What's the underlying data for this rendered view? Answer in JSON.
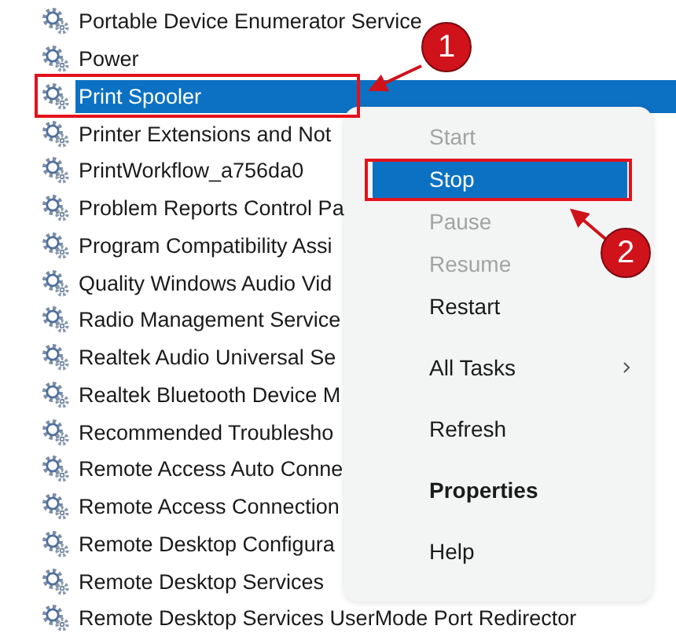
{
  "services": [
    {
      "name": "Portable Device Enumerator Service",
      "selected": false
    },
    {
      "name": "Power",
      "selected": false
    },
    {
      "name": "Print Spooler",
      "selected": true
    },
    {
      "name": "Printer Extensions and Not",
      "selected": false
    },
    {
      "name": "PrintWorkflow_a756da0",
      "selected": false
    },
    {
      "name": "Problem Reports Control Pa",
      "selected": false
    },
    {
      "name": "Program Compatibility Assi",
      "selected": false
    },
    {
      "name": "Quality Windows Audio Vid",
      "selected": false
    },
    {
      "name": "Radio Management Service",
      "selected": false
    },
    {
      "name": "Realtek Audio Universal Se",
      "selected": false
    },
    {
      "name": "Realtek Bluetooth Device M",
      "selected": false
    },
    {
      "name": "Recommended Troublesho",
      "selected": false
    },
    {
      "name": "Remote Access Auto Conne",
      "selected": false
    },
    {
      "name": "Remote Access Connection",
      "selected": false
    },
    {
      "name": "Remote Desktop Configura",
      "selected": false
    },
    {
      "name": "Remote Desktop Services",
      "selected": false
    },
    {
      "name": "Remote Desktop Services UserMode Port Redirector",
      "selected": false
    }
  ],
  "context_menu": {
    "items": [
      {
        "kind": "item",
        "label": "Start",
        "disabled": true,
        "selected": false,
        "bold": false,
        "submenu": false
      },
      {
        "kind": "item",
        "label": "Stop",
        "disabled": false,
        "selected": true,
        "bold": false,
        "submenu": false
      },
      {
        "kind": "item",
        "label": "Pause",
        "disabled": true,
        "selected": false,
        "bold": false,
        "submenu": false
      },
      {
        "kind": "item",
        "label": "Resume",
        "disabled": true,
        "selected": false,
        "bold": false,
        "submenu": false
      },
      {
        "kind": "item",
        "label": "Restart",
        "disabled": false,
        "selected": false,
        "bold": false,
        "submenu": false
      },
      {
        "kind": "gap"
      },
      {
        "kind": "item",
        "label": "All Tasks",
        "disabled": false,
        "selected": false,
        "bold": false,
        "submenu": true
      },
      {
        "kind": "gap"
      },
      {
        "kind": "item",
        "label": "Refresh",
        "disabled": false,
        "selected": false,
        "bold": false,
        "submenu": false
      },
      {
        "kind": "gap"
      },
      {
        "kind": "item",
        "label": "Properties",
        "disabled": false,
        "selected": false,
        "bold": true,
        "submenu": false
      },
      {
        "kind": "gap"
      },
      {
        "kind": "item",
        "label": "Help",
        "disabled": false,
        "selected": false,
        "bold": false,
        "submenu": false
      }
    ]
  },
  "annotations": [
    {
      "label": "1"
    },
    {
      "label": "2"
    }
  ]
}
